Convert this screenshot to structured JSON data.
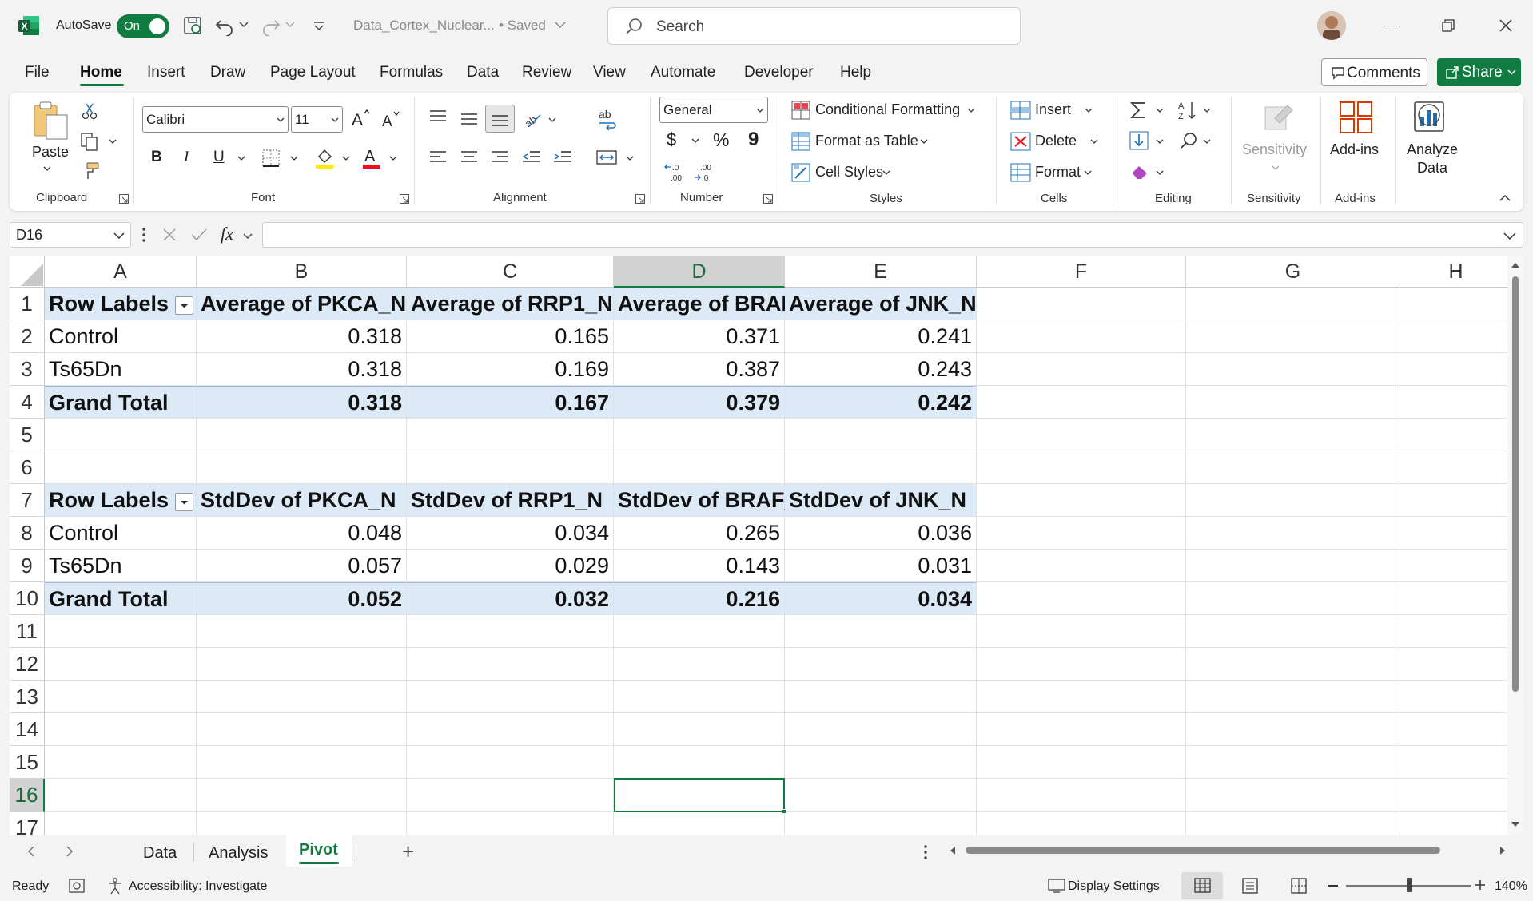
{
  "titlebar": {
    "autosave_label": "AutoSave",
    "autosave_state": "On",
    "file_name": "Data_Cortex_Nuclear...",
    "save_status": "• Saved",
    "search_placeholder": "Search"
  },
  "menu": {
    "items": [
      "File",
      "Home",
      "Insert",
      "Draw",
      "Page Layout",
      "Formulas",
      "Data",
      "Review",
      "View",
      "Automate",
      "Developer",
      "Help"
    ],
    "active": "Home",
    "comments_label": "Comments",
    "share_label": "Share"
  },
  "ribbon": {
    "clipboard": {
      "paste_label": "Paste",
      "group_label": "Clipboard"
    },
    "font": {
      "font_name": "Calibri",
      "font_size": "11",
      "group_label": "Font",
      "bold": "B",
      "italic": "I",
      "underline": "U"
    },
    "alignment": {
      "group_label": "Alignment"
    },
    "number": {
      "format": "General",
      "group_label": "Number",
      "currency": "$",
      "percent": "%",
      "comma": "9"
    },
    "styles": {
      "conditional": "Conditional Formatting",
      "format_table": "Format as Table",
      "cell_styles": "Cell Styles",
      "group_label": "Styles"
    },
    "cells": {
      "insert": "Insert",
      "delete": "Delete",
      "format": "Format",
      "group_label": "Cells"
    },
    "editing": {
      "group_label": "Editing"
    },
    "sensitivity": {
      "label": "Sensitivity",
      "group_label": "Sensitivity"
    },
    "addins": {
      "label": "Add-ins",
      "group_label": "Add-ins"
    },
    "analyze": {
      "label1": "Analyze",
      "label2": "Data"
    }
  },
  "formula_bar": {
    "name_box": "D16",
    "fx": "fx",
    "value": ""
  },
  "sheet": {
    "columns": [
      "A",
      "B",
      "C",
      "D",
      "E",
      "F",
      "G",
      "H"
    ],
    "selected_column": "D",
    "selected_row": "16",
    "row_numbers": [
      "1",
      "2",
      "3",
      "4",
      "5",
      "6",
      "7",
      "8",
      "9",
      "10",
      "11",
      "12",
      "13",
      "14",
      "15",
      "16",
      "17"
    ],
    "pivot1": {
      "headers": [
        "Row Labels",
        "Average of PKCA_N",
        "Average of RRP1_N",
        "Average of BRAF_N",
        "Average of JNK_N"
      ],
      "rows": [
        [
          "Control",
          "0.318",
          "0.165",
          "0.371",
          "0.241"
        ],
        [
          "Ts65Dn",
          "0.318",
          "0.169",
          "0.387",
          "0.243"
        ]
      ],
      "total": [
        "Grand Total",
        "0.318",
        "0.167",
        "0.379",
        "0.242"
      ]
    },
    "pivot2": {
      "headers": [
        "Row Labels",
        "StdDev of PKCA_N",
        "StdDev of RRP1_N",
        "StdDev of BRAF_N",
        "StdDev of JNK_N"
      ],
      "rows": [
        [
          "Control",
          "0.048",
          "0.034",
          "0.265",
          "0.036"
        ],
        [
          "Ts65Dn",
          "0.057",
          "0.029",
          "0.143",
          "0.031"
        ]
      ],
      "total": [
        "Grand Total",
        "0.052",
        "0.032",
        "0.216",
        "0.034"
      ]
    }
  },
  "tabs": {
    "items": [
      "Data",
      "Analysis",
      "Pivot"
    ],
    "active": "Pivot",
    "add": "+"
  },
  "status": {
    "ready": "Ready",
    "accessibility": "Accessibility: Investigate",
    "display_settings": "Display Settings",
    "zoom": "140%"
  },
  "colors": {
    "accent": "#107c41",
    "pivot_band": "#dce9f6"
  }
}
